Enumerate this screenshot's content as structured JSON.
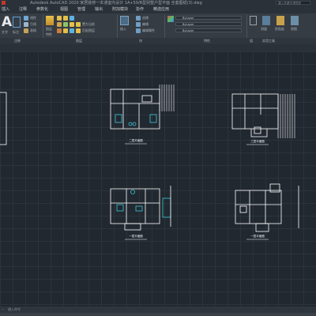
{
  "title_bar": {
    "title": "Autodesk AutoCAD 2020   家居装修一本通室内设计  1A+59/B型别墅户型平面  全套图纸(3).dwg",
    "search_placeholder": "键入关键字或短语"
  },
  "menu_bar": {
    "items": [
      "插入",
      "注释",
      "参数化",
      "视图",
      "管理",
      "输出",
      "附加模块",
      "协作",
      "精选应用"
    ]
  },
  "ribbon": {
    "draw_big_label": "A",
    "draw_labels": [
      "文字",
      "标注"
    ],
    "small_tools": [
      "线性",
      "引线",
      "表格"
    ],
    "layer_labels": [
      "图层",
      "特性"
    ],
    "block_labels": [
      "插入",
      "创建",
      "编辑",
      "编辑属性"
    ],
    "properties_dropdowns": [
      "ByLayer",
      "ByLayer",
      "ByLayer"
    ],
    "layer_tools": [
      "置为当前",
      "匹配图层"
    ],
    "right_tools": [
      "测量",
      "组",
      "实用工具",
      "剪贴板",
      "视图"
    ],
    "panel_names": [
      "注释",
      "图层",
      "块",
      "特性",
      "组",
      "实用工具"
    ]
  },
  "drawings": [
    {
      "caption": "二层平面图"
    },
    {
      "caption": "三层平面图"
    },
    {
      "caption": "一层平面图"
    },
    {
      "caption": "一层平面图"
    }
  ],
  "command_line": {
    "placeholder": "键入命令"
  },
  "colors": {
    "background": "#212830",
    "line_work": "#ffffff",
    "accent_cyan": "#3fc8d6",
    "grid": "#2b333c"
  }
}
